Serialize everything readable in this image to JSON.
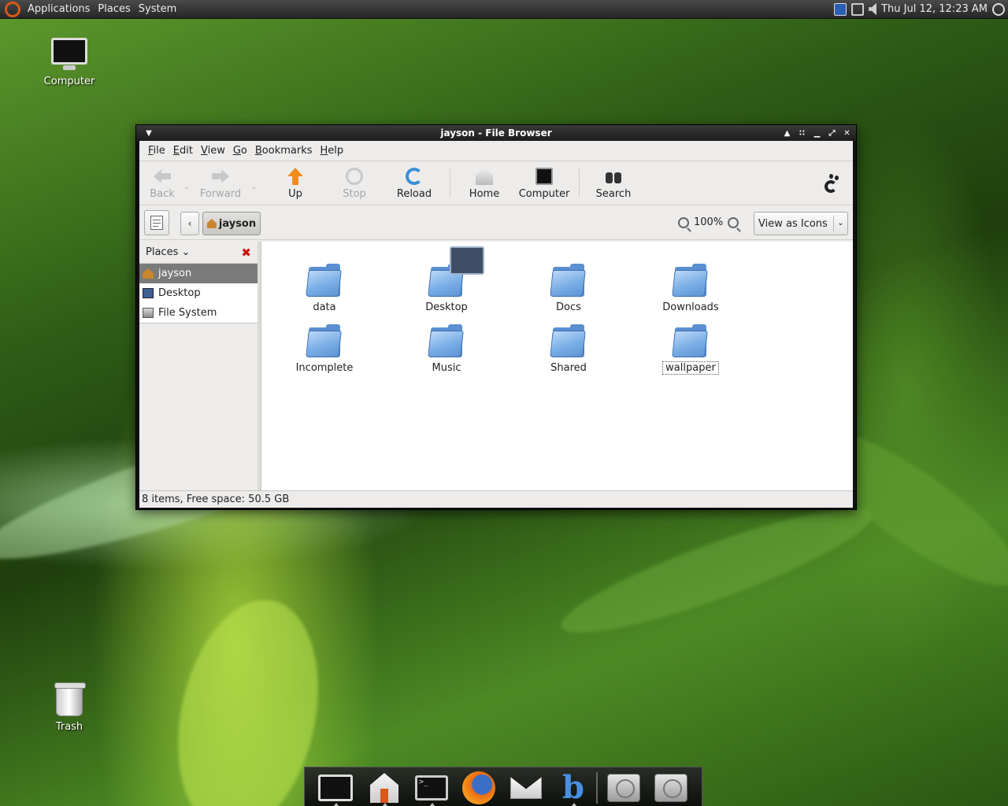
{
  "top_panel": {
    "menus": [
      "Applications",
      "Places",
      "System"
    ],
    "clock": "Thu Jul 12, 12:23 AM"
  },
  "desktop": {
    "icons": [
      {
        "label": "Computer"
      },
      {
        "label": "Trash"
      }
    ]
  },
  "window": {
    "title": "jayson - File Browser",
    "menubar": [
      "File",
      "Edit",
      "View",
      "Go",
      "Bookmarks",
      "Help"
    ],
    "toolbar": {
      "back": "Back",
      "forward": "Forward",
      "up": "Up",
      "stop": "Stop",
      "reload": "Reload",
      "home": "Home",
      "computer": "Computer",
      "search": "Search"
    },
    "location": {
      "crumb": "jayson",
      "zoom": "100%",
      "view_mode": "View as Icons"
    },
    "sidebar": {
      "header": "Places",
      "items": [
        {
          "label": "jayson",
          "selected": true
        },
        {
          "label": "Desktop",
          "selected": false
        },
        {
          "label": "File System",
          "selected": false
        }
      ]
    },
    "files": [
      {
        "name": "data"
      },
      {
        "name": "Desktop"
      },
      {
        "name": "Docs"
      },
      {
        "name": "Downloads"
      },
      {
        "name": "Incomplete"
      },
      {
        "name": "Music"
      },
      {
        "name": "Shared"
      },
      {
        "name": "wallpaper"
      }
    ],
    "status": "8 items, Free space: 50.5 GB"
  },
  "colors": {
    "accent_orange": "#d8591b",
    "folder_blue": "#5b8fd2",
    "selection_gray": "#7a7a7a"
  }
}
